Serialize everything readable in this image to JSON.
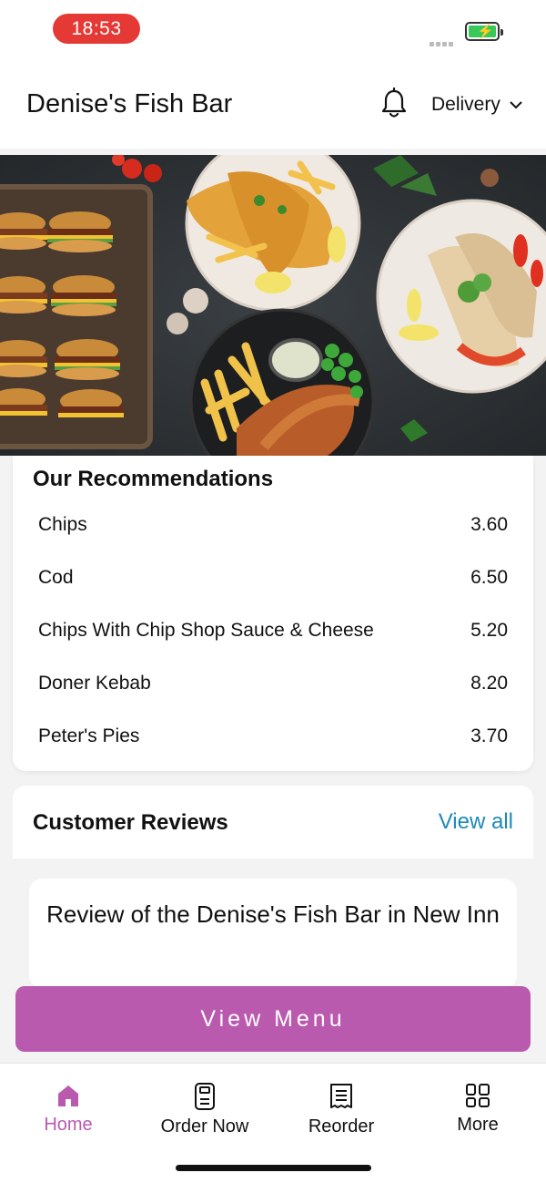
{
  "status_bar": {
    "time": "18:53"
  },
  "header": {
    "title": "Denise's Fish Bar",
    "delivery_label": "Delivery"
  },
  "recommendations": {
    "title": "Our Recommendations",
    "items": [
      {
        "name": "Chips",
        "price": "3.60"
      },
      {
        "name": "Cod",
        "price": "6.50"
      },
      {
        "name": "Chips With Chip Shop Sauce & Cheese",
        "price": "5.20"
      },
      {
        "name": "Doner Kebab",
        "price": "8.20"
      },
      {
        "name": "Peter's Pies",
        "price": "3.70"
      }
    ]
  },
  "reviews": {
    "title": "Customer Reviews",
    "view_all": "View all",
    "review_heading": "Review of the Denise's Fish Bar in New Inn"
  },
  "cta": {
    "view_menu": "View Menu"
  },
  "tabbar": {
    "items": [
      {
        "label": "Home",
        "icon": "home-icon",
        "active": true
      },
      {
        "label": "Order Now",
        "icon": "order-icon",
        "active": false
      },
      {
        "label": "Reorder",
        "icon": "receipt-icon",
        "active": false
      },
      {
        "label": "More",
        "icon": "grid-icon",
        "active": false
      }
    ]
  },
  "colors": {
    "accent": "#b95aaf",
    "link": "#1e8ab8",
    "status_pill": "#e53935",
    "battery": "#38c95a"
  }
}
